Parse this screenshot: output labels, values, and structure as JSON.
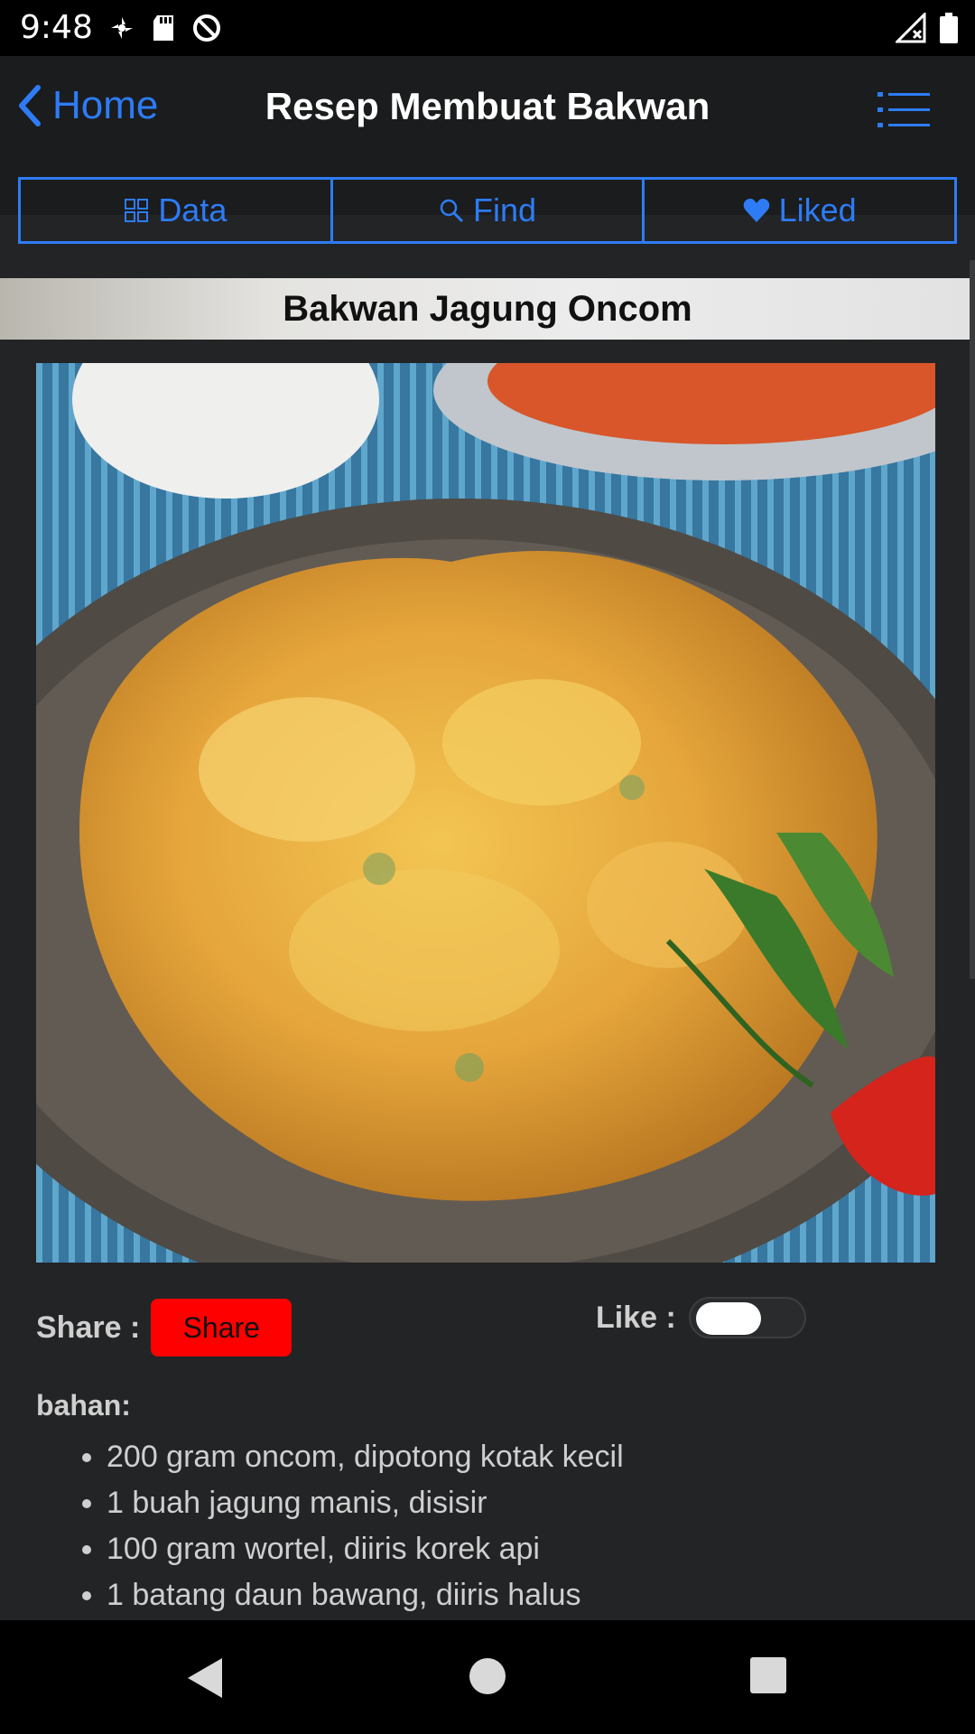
{
  "status_bar": {
    "time": "9:48",
    "left_icons": [
      "fan-icon",
      "sd-card-icon",
      "sync-icon"
    ],
    "right_icons": [
      "signal-icon",
      "battery-icon"
    ]
  },
  "nav": {
    "back_label": "Home",
    "title": "Resep Membuat Bakwan",
    "menu_icon": "list-icon"
  },
  "tabs": [
    {
      "label": "Data",
      "icon": "grid-icon"
    },
    {
      "label": "Find",
      "icon": "search-icon"
    },
    {
      "label": "Liked",
      "icon": "heart-icon"
    }
  ],
  "recipe": {
    "title": "Bakwan Jagung Oncom",
    "share_label": "Share :",
    "share_button": "Share",
    "like_label": "Like :",
    "like_on": false,
    "ingredients_title": "bahan:",
    "ingredients": [
      "200 gram oncom, dipotong kotak kecil",
      "1 buah jagung manis, disisir",
      "100 gram wortel, diiris korek api",
      "1 batang daun bawang, diiris halus"
    ]
  },
  "colors": {
    "accent": "#2d7cf6",
    "share_button": "#ff0000",
    "background": "#232426"
  },
  "system_nav": [
    "back-icon",
    "home-icon",
    "recents-icon"
  ]
}
